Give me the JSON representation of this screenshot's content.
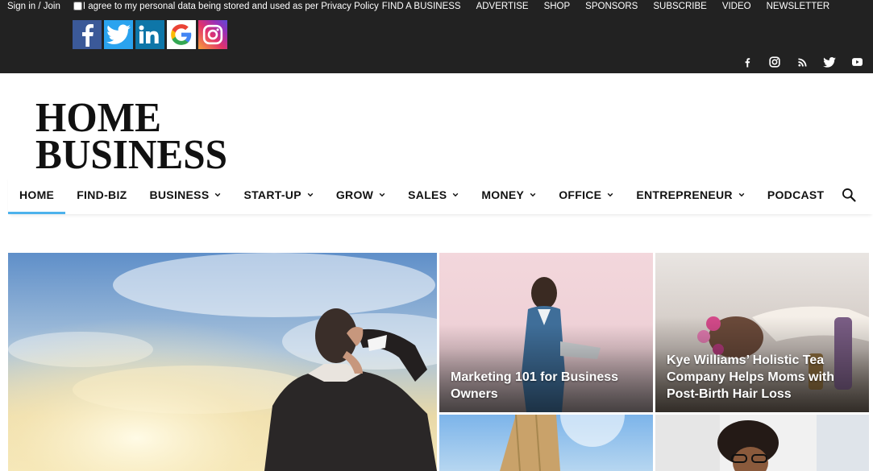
{
  "topbar": {
    "sign_in": "Sign in / Join",
    "consent_text": "I agree to my personal data being stored and used as per Privacy Policy",
    "links": [
      "FIND A BUSINESS",
      "ADVERTISE",
      "SHOP",
      "SPONSORS",
      "SUBSCRIBE",
      "VIDEO",
      "NEWSLETTER"
    ],
    "social_tiles": [
      "facebook-icon",
      "twitter-icon",
      "linkedin-icon",
      "google-icon",
      "instagram-icon"
    ],
    "right_social": [
      "facebook-icon",
      "instagram-icon",
      "rss-icon",
      "twitter-icon",
      "youtube-icon"
    ]
  },
  "logo": {
    "line1": "HOME",
    "line2": "BUSINESS"
  },
  "nav": {
    "items": [
      {
        "label": "HOME",
        "dropdown": false,
        "active": true
      },
      {
        "label": "FIND-BIZ",
        "dropdown": false
      },
      {
        "label": "BUSINESS",
        "dropdown": true
      },
      {
        "label": "START-UP",
        "dropdown": true
      },
      {
        "label": "GROW",
        "dropdown": true
      },
      {
        "label": "SALES",
        "dropdown": true
      },
      {
        "label": "MONEY",
        "dropdown": true
      },
      {
        "label": "OFFICE",
        "dropdown": true
      },
      {
        "label": "ENTREPRENEUR",
        "dropdown": true
      },
      {
        "label": "PODCAST",
        "dropdown": false
      }
    ],
    "search_icon": "search-icon"
  },
  "cards": [
    {
      "title": "Marketing 101 for Business Owners"
    },
    {
      "title": "Kye Williams’ Holistic Tea Company Helps Moms with Post-Birth Hair Loss"
    }
  ],
  "colors": {
    "topbar_bg": "#222222",
    "accent": "#4db2ec"
  }
}
